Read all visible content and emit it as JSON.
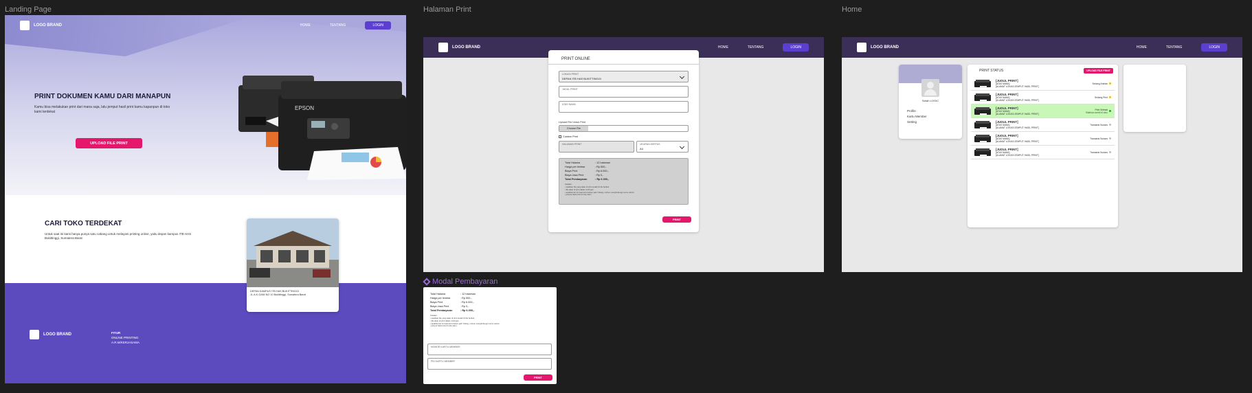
{
  "frames": {
    "landing_label": "Landing Page",
    "print_label": "Halaman Print",
    "home_label": "Home",
    "modal_label": "Modal Pembayaran"
  },
  "nav": {
    "brand": "LOGO BRAND",
    "home": "HOME",
    "about": "TENTANG",
    "login": "LOGIN"
  },
  "landing": {
    "hero_title": "PRINT DOKUMEN KAMU DARI MANAPUN",
    "hero_subtitle": "Kamu bisa melakukan print dari mana saja, lalu jemput hasil print kamu kapanpun di toko kami terdekat",
    "hero_button": "UPLOAD FILE PRINT",
    "printer_brand": "EPSON",
    "find_title": "CARI TOKO TERDEKAT",
    "find_subtitle": "Untuk saat ini kami hanya punya satu cabang untuk melayani printing online, yaitu depan kampus ITB HAS Bukittinggi, Sumatera Barat",
    "store_caption_1": "DEPAN KAMPUS ITB HAS BUKITTINGGI",
    "store_caption_2": "JL.A.K GANI NO 10 Bukittinggi, Sumatera Barat",
    "footer_brand": "LOGO BRAND",
    "footer_menu_title": "FITUR",
    "footer_menu_1": "ONLINE PRINTING",
    "footer_menu_2": "A.R.M/KERJASAMA"
  },
  "print_form": {
    "title": "PRINT ONLINE",
    "location_label": "LOKASI PRINT",
    "location_value": "DEPAN ITB HAS BUKITTINGGI",
    "judul_label": "JUDUL PRINT",
    "nama_label": "ATAS NAMA",
    "upload_label": "Upload File Untuk Print",
    "choose_file": "Choose File",
    "custom_print": "Custom Print",
    "halaman_label": "HALAMAN PRINT",
    "ukuran_label": "UKURAN KERTAS",
    "ukuran_value": "A4",
    "print_button": "PRINT"
  },
  "summary": {
    "rows": [
      {
        "k": "Total Halama",
        "v": ": 12 halaman"
      },
      {
        "k": "Harga per lembar",
        "v": ": Rp 500,-"
      },
      {
        "k": "Biaya Print",
        "v": ": Rp 6.000,-"
      },
      {
        "k": "Biaya Jasa Print",
        "v": ": Rp 0,-"
      },
      {
        "k": "Total Pembayaran",
        "v": ": Rp 6.000,-"
      }
    ],
    "notes_title": "Catatan:",
    "notes": [
      "• pastikan file yang akan di print sudah di file berikut",
      "• file akan di print dalam 1x24 jam",
      "• apabila hari ini hasil print belum jadi / hilang, mohon menghubungi nomor admin",
      "• jemput hasil print di toko kami"
    ]
  },
  "home": {
    "profile_name": "Sarah LOGIC",
    "menu": [
      "Profile",
      "Kartu Member",
      "Setting"
    ],
    "status_title": "PRINT STATUS",
    "upload_button": "UPLOAD FILE PRINT",
    "items": [
      {
        "title": "[JUDUL PRINT]",
        "l2": "[ATAS NAMA]",
        "l3": "[ALAMAT LOKASI JEMPUT HASIL PRINT]",
        "status": "Sedang Antrian",
        "color": "#e6c200",
        "hl": false
      },
      {
        "title": "[JUDUL PRINT]",
        "l2": "[ATAS NAMA]",
        "l3": "[ALAMAT LOKASI JEMPUT HASIL PRINT]",
        "status": "Sedang Print",
        "color": "#e6c200",
        "hl": false
      },
      {
        "title": "[JUDUL PRINT]",
        "l2": "[ATAS NAMA]",
        "l3": "[ALAMAT LOKASI JEMPUT HASIL PRINT]",
        "status": "Print Selesai",
        "color": "#2ca02c",
        "hl": true
      },
      {
        "title": "[JUDUL PRINT]",
        "l2": "[ATAS NAMA]",
        "l3": "[ALAMAT LOKASI JEMPUT HASIL PRINT]",
        "status": "Transaksi Sukses",
        "color": "#bdbdbd",
        "hl": false
      },
      {
        "title": "[JUDUL PRINT]",
        "l2": "[ATAS NAMA]",
        "l3": "[ALAMAT LOKASI JEMPUT HASIL PRINT]",
        "status": "Transaksi Sukses",
        "color": "#bdbdbd",
        "hl": false
      },
      {
        "title": "[JUDUL PRINT]",
        "l2": "[ATAS NAMA]",
        "l3": "[ALAMAT LOKASI JEMPUT HASIL PRINT]",
        "status": "Transaksi Sukses",
        "color": "#bdbdbd",
        "hl": false
      }
    ],
    "highlight_note": "Silahkan ambil di toko"
  },
  "modal": {
    "kartu_label": "NOMOR KARTU MEMBER",
    "pin_label": "PIN KARTU MEMBER",
    "button": "PRINT"
  },
  "colors": {
    "accent": "#5b3fd1",
    "pink": "#e5176c",
    "nav_dark": "#3b2f57",
    "footer": "#5b4bbf"
  }
}
